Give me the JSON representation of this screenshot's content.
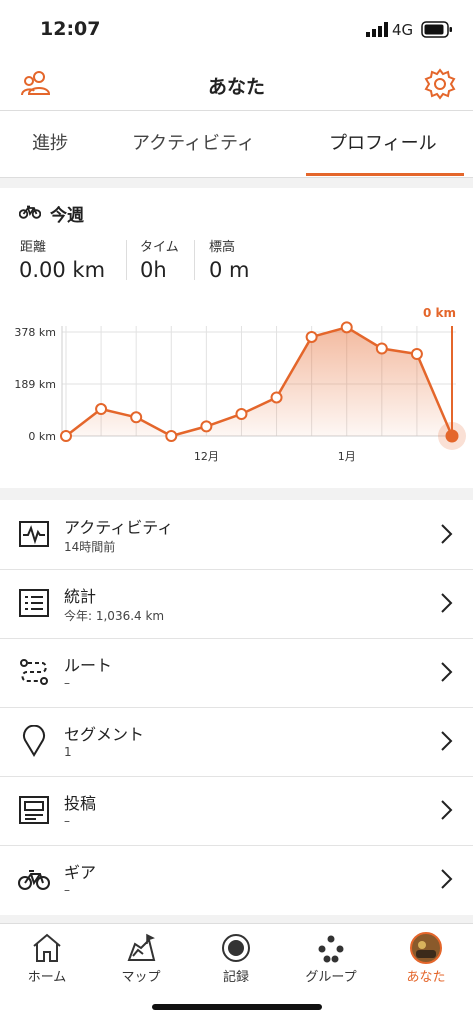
{
  "status": {
    "time": "12:07",
    "network": "4G"
  },
  "header": {
    "title": "あなた"
  },
  "tabs": [
    {
      "label": "進捗"
    },
    {
      "label": "アクティビティ"
    },
    {
      "label": "プロフィール"
    }
  ],
  "week": {
    "title": "今週",
    "stats": [
      {
        "label": "距離",
        "value": "0.00 km"
      },
      {
        "label": "タイム",
        "value": "0h"
      },
      {
        "label": "標高",
        "value": "0 m"
      }
    ]
  },
  "chart_data": {
    "type": "line",
    "y_ticks": [
      "378 km",
      "189 km",
      "0 km"
    ],
    "x_labels": [
      "12月",
      "1月"
    ],
    "current_label": "0 km",
    "ylim": [
      0,
      378
    ],
    "values": [
      0,
      98,
      68,
      0,
      35,
      80,
      140,
      360,
      395,
      318,
      298,
      0
    ],
    "color": "#e4662b"
  },
  "menu": [
    {
      "title": "アクティビティ",
      "subtitle": "14時間前"
    },
    {
      "title": "統計",
      "subtitle": "今年: 1,036.4 km"
    },
    {
      "title": "ルート",
      "subtitle": "–"
    },
    {
      "title": "セグメント",
      "subtitle": "1"
    },
    {
      "title": "投稿",
      "subtitle": "–"
    },
    {
      "title": "ギア",
      "subtitle": "–"
    }
  ],
  "nav": [
    {
      "label": "ホーム"
    },
    {
      "label": "マップ"
    },
    {
      "label": "記録"
    },
    {
      "label": "グループ"
    },
    {
      "label": "あなた"
    }
  ],
  "colors": {
    "accent": "#e4662b"
  }
}
